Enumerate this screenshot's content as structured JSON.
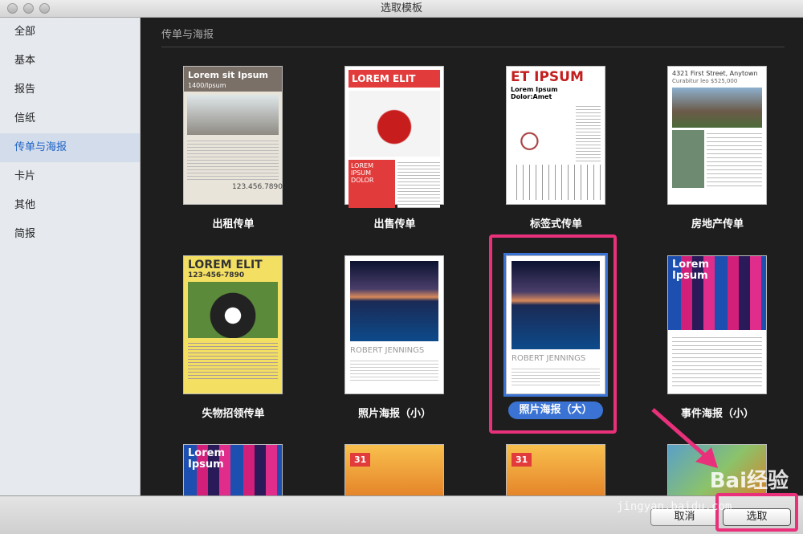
{
  "window": {
    "title": "选取模板"
  },
  "sidebar": {
    "items": [
      {
        "label": "全部"
      },
      {
        "label": "基本"
      },
      {
        "label": "报告"
      },
      {
        "label": "信纸"
      },
      {
        "label": "传单与海报"
      },
      {
        "label": "卡片"
      },
      {
        "label": "其他"
      },
      {
        "label": "简报"
      }
    ],
    "selected": "传单与海报"
  },
  "section": {
    "title": "传单与海报"
  },
  "templates": [
    {
      "label": "出租传单",
      "preview_title": "Lorem sit Ipsum",
      "preview_sub": "1400/Ipsum",
      "preview_extra": "123.456.7890"
    },
    {
      "label": "出售传单",
      "preview_title": "LOREM ELIT",
      "preview_extra": "LOREM IPSUM DOLOR"
    },
    {
      "label": "标签式传单",
      "preview_title": "ET IPSUM",
      "preview_sub": "Lorem Ipsum Dolor:Amet"
    },
    {
      "label": "房地产传单",
      "preview_title": "4321 First Street, Anytown",
      "preview_sub": "Curabitur leo $525,000"
    },
    {
      "label": "失物招领传单",
      "preview_title": "LOREM ELIT",
      "preview_sub": "123-456-7890"
    },
    {
      "label": "照片海报（小）",
      "preview_title": "ROBERT JENNINGS"
    },
    {
      "label": "照片海报（大）",
      "preview_title": "ROBERT JENNINGS",
      "selected": true
    },
    {
      "label": "事件海报（小）",
      "preview_title": "Lorem Ipsum"
    },
    {
      "label": "",
      "preview_title": "Lorem Ipsum"
    },
    {
      "label": "",
      "preview_title": "31"
    },
    {
      "label": "",
      "preview_title": "31"
    },
    {
      "label": ""
    }
  ],
  "buttons": {
    "cancel": "取消",
    "choose": "选取"
  },
  "watermark": {
    "brand": "Bai经验",
    "url": "jingyan.baidu.com"
  },
  "colors": {
    "selection_pill": "#3a73d4",
    "annotation": "#e8317a"
  }
}
